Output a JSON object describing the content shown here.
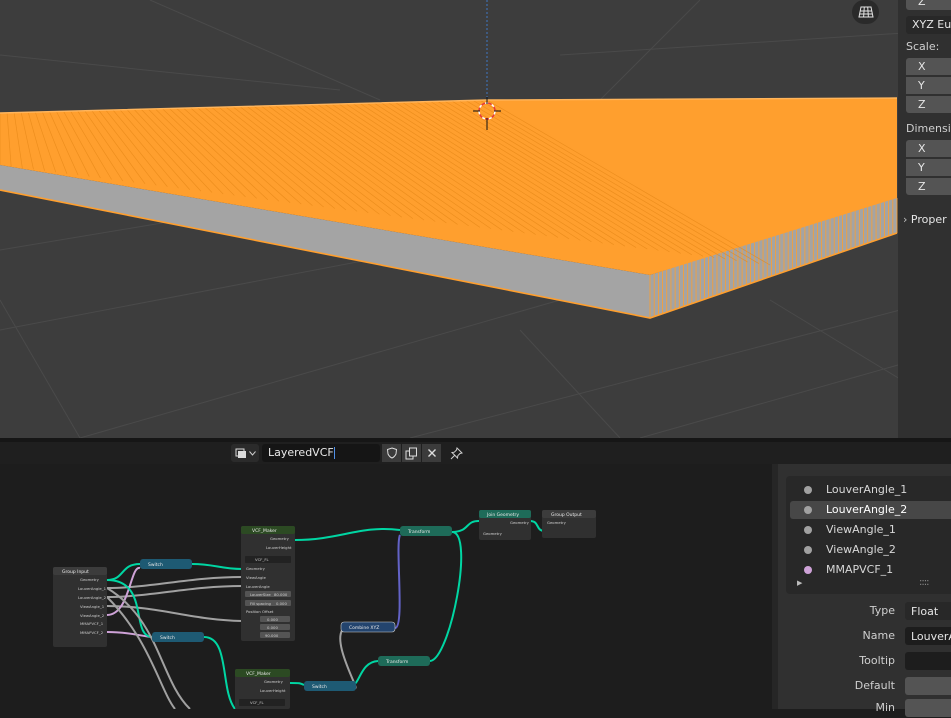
{
  "viewport": {
    "rotation_mode": "XYZ Eul",
    "rotation_z_label": "Z",
    "scale_heading": "Scale:",
    "scale_axes": [
      "X",
      "Y",
      "Z"
    ],
    "dimensions_heading": "Dimensio",
    "dimensions_axes": [
      "X",
      "Y",
      "Z"
    ],
    "properties_label": "Proper",
    "icon": "grid-ortho-icon",
    "selection_color": "#ff9f2e"
  },
  "node_editor": {
    "tree_name": "LayeredVCF",
    "header_icons": [
      "node-tree-type-icon",
      "fake-user-shield-icon",
      "duplicate-icon",
      "unlink-x-icon",
      "pin-icon"
    ],
    "nodes": {
      "group_input": {
        "title": "Group Input",
        "sockets": [
          "Geometry",
          "LouverAngle_1",
          "LouverAngle_2",
          "ViewAngle_1",
          "ViewAngle_2",
          "MMAPVCF_1",
          "MMAPVCF_2"
        ]
      },
      "vcf_maker_1": {
        "title": "VCF_Maker",
        "outputs": [
          "Geometry",
          "LouverHeight"
        ],
        "group": "VCF_FL",
        "inputs": [
          "Geometry",
          "ViewAngle",
          "LouverAngle",
          "LouverSize",
          "Fill spacing",
          "Position Offset"
        ],
        "louver_size": "80.000",
        "fill_spacing": "0.000",
        "offsets": [
          "0.000",
          "0.000",
          "90.000"
        ]
      },
      "vcf_maker_2": {
        "title": "VCF_Maker",
        "outputs": [
          "Geometry",
          "LouverHeight"
        ],
        "group": "VCF_FL"
      },
      "switch_1": {
        "title": "Switch"
      },
      "switch_2": {
        "title": "Switch"
      },
      "switch_3": {
        "title": "Switch"
      },
      "transform_1": {
        "title": "Transform"
      },
      "transform_2": {
        "title": "Transform"
      },
      "combine_xyz": {
        "title": "Combine XYZ"
      },
      "join_geometry": {
        "title": "Join Geometry",
        "sockets": [
          "Geometry",
          "Geometry"
        ]
      },
      "group_output": {
        "title": "Group Output",
        "sockets": [
          "Geometry"
        ]
      }
    },
    "link_colors": {
      "geometry": "#00d6a3",
      "float": "#a1a1a1",
      "vector": "#6363c7",
      "shader": "#cea2d7"
    }
  },
  "sidebar": {
    "interface_items": [
      {
        "label": "LouverAngle_1",
        "socket": "float"
      },
      {
        "label": "LouverAngle_2",
        "socket": "float",
        "active": true
      },
      {
        "label": "ViewAngle_1",
        "socket": "float"
      },
      {
        "label": "ViewAngle_2",
        "socket": "float"
      },
      {
        "label": "MMAPVCF_1",
        "socket": "shader"
      }
    ],
    "properties": {
      "type_label": "Type",
      "type_value": "Float",
      "name_label": "Name",
      "name_value": "LouverA",
      "tooltip_label": "Tooltip",
      "tooltip_value": "",
      "default_label": "Default",
      "default_value": "",
      "min_label": "Min",
      "min_value": ""
    }
  }
}
